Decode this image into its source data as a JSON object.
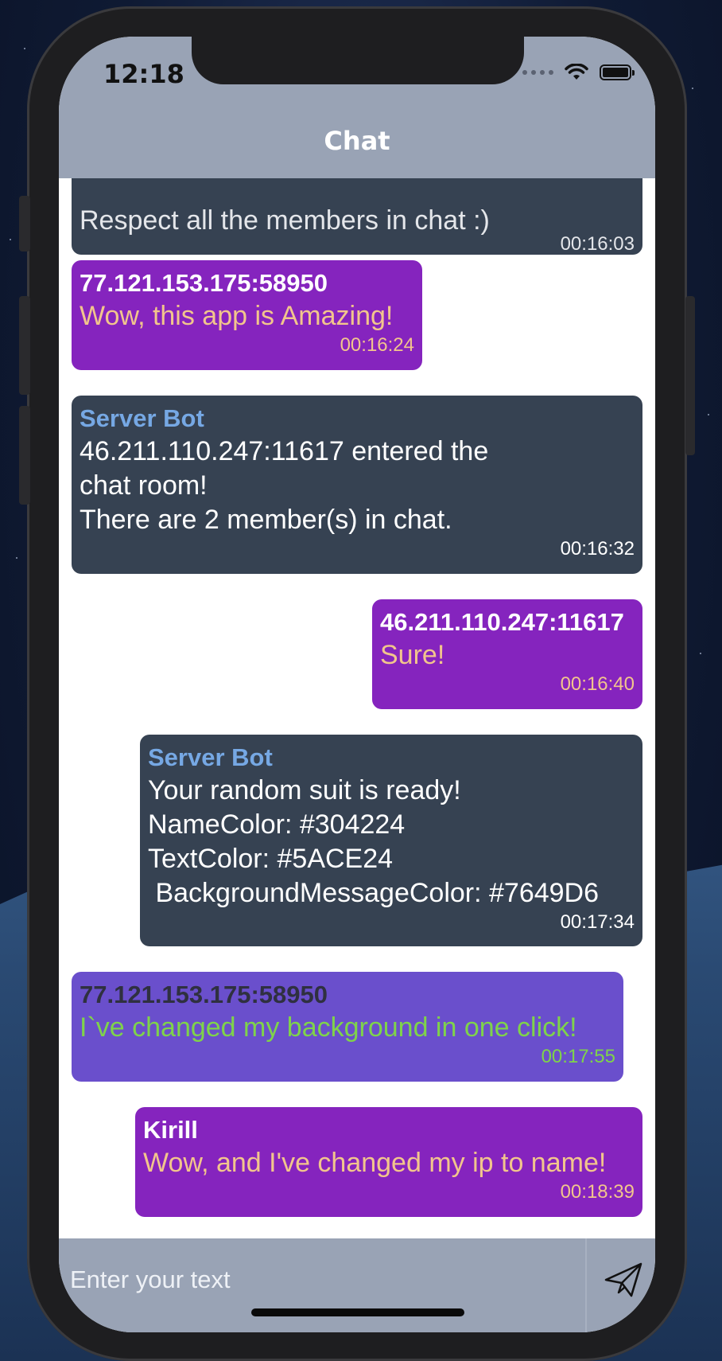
{
  "status_bar": {
    "time": "12:18"
  },
  "header": {
    "title": "Chat"
  },
  "messages": [
    {
      "name": "",
      "text": "Respect all the members in chat :)",
      "time": "00:16:03"
    },
    {
      "name": "77.121.153.175:58950",
      "text": "Wow, this app is Amazing!",
      "time": "00:16:24"
    },
    {
      "name": "Server Bot",
      "text": "46.211.110.247:11617 entered the\nchat room!\nThere are 2 member(s) in chat.",
      "time": "00:16:32"
    },
    {
      "name": "46.211.110.247:11617",
      "text": "Sure!",
      "time": "00:16:40"
    },
    {
      "name": "Server Bot",
      "text": "Your random suit is ready!\nNameColor: #304224\nTextColor: #5ACE24\n BackgroundMessageColor: #7649D6",
      "time": "00:17:34"
    },
    {
      "name": "77.121.153.175:58950",
      "text": "I`ve changed my background in one click!",
      "time": "00:17:55"
    },
    {
      "name": "Kirill",
      "text": "Wow, and I've changed my ip to name!",
      "time": "00:18:39"
    }
  ],
  "composer": {
    "placeholder": "Enter your text",
    "send_icon": "paper-plane-icon"
  },
  "colors": {
    "header_bg": "#99a3b5",
    "bot_bubble": "#364252",
    "purple_bubble": "#8524be",
    "custom_bubble": "#6a4fcc",
    "bot_name": "#76a8e4",
    "peach_text": "#f2c58c",
    "custom_text": "#7fd34a"
  }
}
